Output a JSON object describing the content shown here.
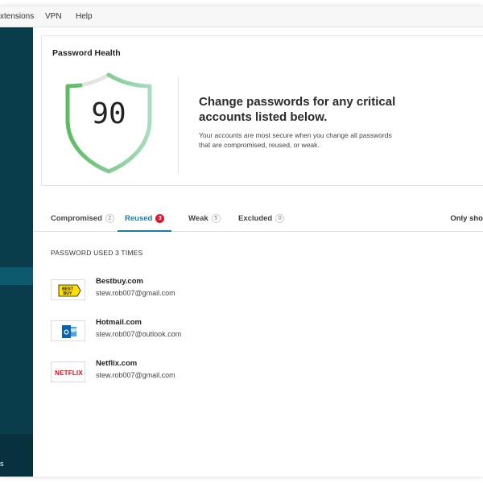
{
  "menu": {
    "items": [
      "xtensions",
      "VPN",
      "Help"
    ]
  },
  "sidebar": {
    "bottom_label": "s"
  },
  "health": {
    "title": "Password Health",
    "score": "90",
    "headline": "Change passwords for any critical accounts listed below.",
    "subtext": "Your accounts are most secure when you change all passwords that are compromised, reused, or weak."
  },
  "tabs": [
    {
      "label": "Compromised",
      "count": "2"
    },
    {
      "label": "Reused",
      "count": "3"
    },
    {
      "label": "Weak",
      "count": "5"
    },
    {
      "label": "Excluded",
      "count": "0"
    }
  ],
  "only_show": "Only sho",
  "group": {
    "heading": "PASSWORD USED 3 TIMES"
  },
  "accounts": [
    {
      "site": "Bestbuy.com",
      "user": "stew.rob007@gmail.com",
      "logo": "bestbuy-logo",
      "logo_text": "BEST BUY"
    },
    {
      "site": "Hotmail.com",
      "user": "stew.rob007@outlook.com",
      "logo": "outlook-logo",
      "logo_text": ""
    },
    {
      "site": "Netflix.com",
      "user": "stew.rob007@gmail.com",
      "logo": "netflix-logo",
      "logo_text": "NETFLIX"
    }
  ],
  "colors": {
    "sidebar": "#0a3d4c",
    "accent": "#1a7ea3",
    "alert": "#e0162b",
    "shield_green": "#6cc46c"
  }
}
